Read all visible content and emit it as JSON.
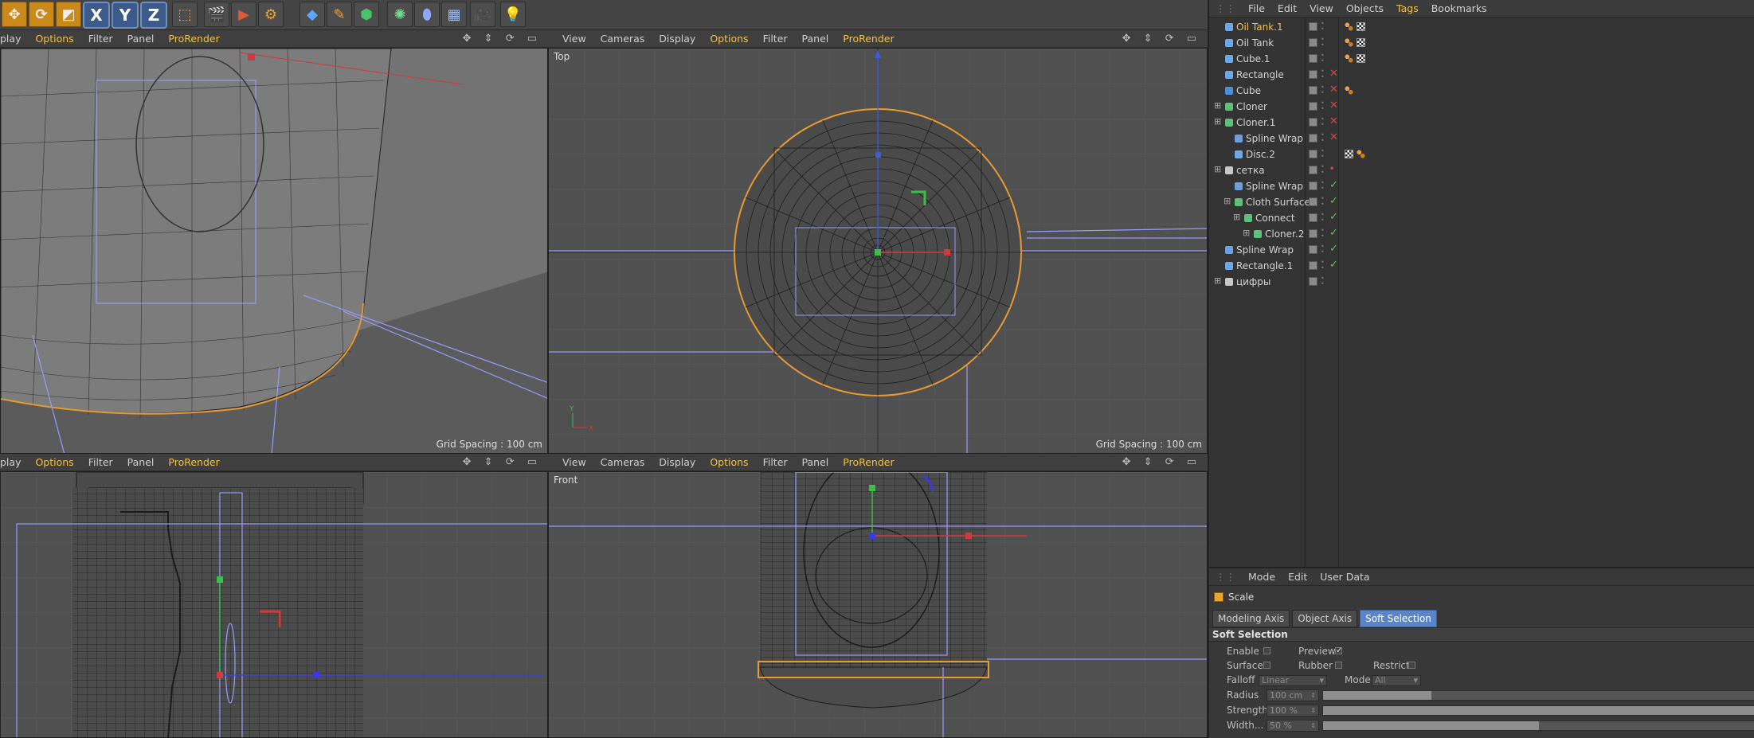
{
  "toolbar": {
    "icons": [
      "move-icon",
      "rotate-icon",
      "scale-icon",
      "x-axis-lock",
      "y-axis-lock",
      "z-axis-lock",
      "world-coord-icon",
      "render-view-icon",
      "render-picture-queue-icon",
      "render-settings-icon",
      "cube-primitive-icon",
      "pen-spline-icon",
      "nurbs-icon",
      "mograph-cloner-icon",
      "deformer-icon",
      "scene-floor-icon",
      "camera-icon",
      "light-icon"
    ],
    "x_label": "X",
    "y_label": "Y",
    "z_label": "Z"
  },
  "viewports": {
    "tl": {
      "menu": [
        "play",
        "Options",
        "Filter",
        "Panel",
        "ProRender"
      ],
      "grid": "Grid Spacing : 100 cm"
    },
    "tr": {
      "menu": [
        "View",
        "Cameras",
        "Display",
        "Options",
        "Filter",
        "Panel",
        "ProRender"
      ],
      "label": "Top",
      "grid": "Grid Spacing : 100 cm"
    },
    "bl": {
      "menu": [
        "play",
        "Options",
        "Filter",
        "Panel",
        "ProRender"
      ]
    },
    "br": {
      "menu": [
        "View",
        "Cameras",
        "Display",
        "Options",
        "Filter",
        "Panel",
        "ProRender"
      ],
      "label": "Front"
    },
    "controls": "✥ ⇕ ⟳ ▭",
    "axis_y": "Y",
    "axis_x": "X"
  },
  "object_manager": {
    "menu": [
      "File",
      "Edit",
      "View",
      "Objects",
      "Tags",
      "Bookmarks"
    ],
    "active_menu": "Tags",
    "objects": [
      {
        "name": "Oil Tank.1",
        "indent": 1,
        "icon_color": "#6fa6e8",
        "selected": true,
        "status": "",
        "tags": [
          "orange",
          "checker"
        ]
      },
      {
        "name": "Oil Tank",
        "indent": 1,
        "icon_color": "#6fa6e8",
        "status": "",
        "tags": [
          "orange",
          "checker"
        ]
      },
      {
        "name": "Cube.1",
        "indent": 1,
        "icon_color": "#6fa6e8",
        "status": "",
        "tags": [
          "orange",
          "checker"
        ]
      },
      {
        "name": "Rectangle",
        "indent": 1,
        "icon_color": "#6fa6e8",
        "status": "x",
        "tags": []
      },
      {
        "name": "Cube",
        "indent": 1,
        "icon_color": "#4a8fd8",
        "status": "x",
        "tags": [
          "orange"
        ]
      },
      {
        "name": "Cloner",
        "indent": 1,
        "icon_color": "#5fc07a",
        "expand": true,
        "status": "x",
        "tags": []
      },
      {
        "name": "Cloner.1",
        "indent": 1,
        "icon_color": "#5fc07a",
        "expand": true,
        "status": "x",
        "tags": []
      },
      {
        "name": "Spline Wrap",
        "indent": 2,
        "icon_color": "#6f9ee0",
        "status": "x",
        "tags": []
      },
      {
        "name": "Disc.2",
        "indent": 2,
        "icon_color": "#6fa6e8",
        "status": "",
        "tags": [
          "checker",
          "orange"
        ]
      },
      {
        "name": "сетка",
        "indent": 1,
        "icon_color": "#c8c8c8",
        "expand": true,
        "status": "dot",
        "tags": []
      },
      {
        "name": "Spline Wrap",
        "indent": 2,
        "icon_color": "#6f9ee0",
        "status": "ok",
        "tags": []
      },
      {
        "name": "Cloth Surface",
        "indent": 2,
        "icon_color": "#5fc07a",
        "expand": true,
        "status": "ok",
        "tags": []
      },
      {
        "name": "Connect",
        "indent": 3,
        "icon_color": "#5fc07a",
        "expand": true,
        "status": "ok",
        "tags": []
      },
      {
        "name": "Cloner.2",
        "indent": 4,
        "icon_color": "#5fc07a",
        "expand": true,
        "status": "ok",
        "tags": []
      },
      {
        "name": "Spline Wrap",
        "indent": 1,
        "icon_color": "#6f9ee0",
        "status": "ok",
        "tags": []
      },
      {
        "name": "Rectangle.1",
        "indent": 1,
        "icon_color": "#6fa6e8",
        "status": "ok",
        "tags": []
      },
      {
        "name": "цифры",
        "indent": 1,
        "icon_color": "#c8c8c8",
        "expand": true,
        "status": "",
        "tags": []
      }
    ]
  },
  "attributes": {
    "menu": [
      "Mode",
      "Edit",
      "User Data"
    ],
    "tool_name": "Scale",
    "tabs": [
      "Modeling Axis",
      "Object Axis",
      "Soft Selection"
    ],
    "active_tab": "Soft Selection",
    "section": "Soft Selection",
    "enable_label": "Enable",
    "preview_label": "Preview",
    "surface_label": "Surface",
    "rubber_label": "Rubber",
    "restrict_label": "Restrict",
    "falloff_label": "Falloff",
    "falloff_value": "Linear",
    "mode_label": "Mode",
    "mode_value": "All",
    "radius_label": "Radius",
    "radius_value": "100 cm",
    "strength_label": "Strength",
    "strength_value": "100 %",
    "width_label": "Width...",
    "width_value": "50 %",
    "preview_checked": true,
    "radius_fill": 0.25,
    "strength_fill": 1.0,
    "width_fill": 0.5
  }
}
